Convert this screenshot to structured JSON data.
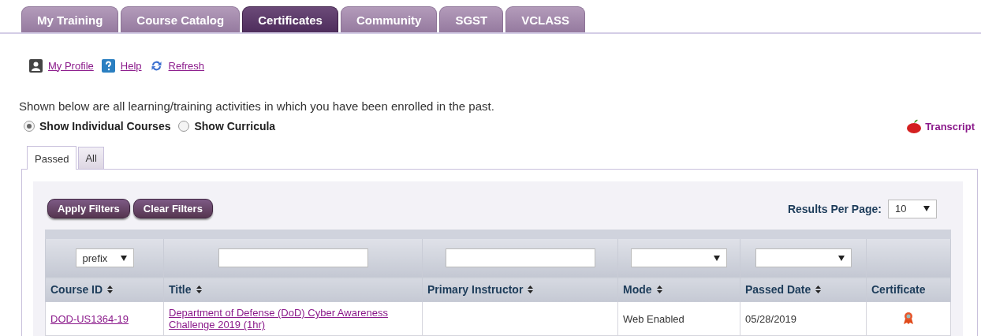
{
  "nav_tabs": [
    {
      "label": "My Training",
      "selected": false
    },
    {
      "label": "Course Catalog",
      "selected": false
    },
    {
      "label": "Certificates",
      "selected": true
    },
    {
      "label": "Community",
      "selected": false
    },
    {
      "label": "SGST",
      "selected": false
    },
    {
      "label": "VCLASS",
      "selected": false
    }
  ],
  "links": [
    {
      "kind": "profile",
      "label": "My Profile"
    },
    {
      "kind": "help",
      "label": "Help"
    },
    {
      "kind": "refresh",
      "label": "Refresh"
    }
  ],
  "intro": "Shown below are all learning/training activities in which you have been enrolled in the past.",
  "view_options": [
    {
      "label": "Show Individual Courses",
      "selected": true
    },
    {
      "label": "Show Curricula",
      "selected": false
    }
  ],
  "transcript_link": "Transcript",
  "sub_tabs": [
    {
      "label": "Passed",
      "selected": true
    },
    {
      "label": "All",
      "selected": false
    }
  ],
  "buttons": [
    "Apply Filters",
    "Clear Filters"
  ],
  "results_per_page": {
    "label": "Results Per Page:",
    "value": "10"
  },
  "table": {
    "filters": [
      {
        "kind": "select",
        "value": "prefix"
      },
      {
        "kind": "text"
      },
      {
        "kind": "text"
      },
      {
        "kind": "select"
      },
      {
        "kind": "select"
      },
      {
        "kind": "none"
      }
    ],
    "columns": [
      {
        "label": "Course ID",
        "sortable": true
      },
      {
        "label": "Title",
        "sortable": true
      },
      {
        "label": "Primary Instructor",
        "sortable": true
      },
      {
        "label": "Mode",
        "sortable": true
      },
      {
        "label": "Passed Date",
        "sortable": true
      },
      {
        "label": "Certificate",
        "sortable": false
      }
    ],
    "rows": [
      {
        "course_id": "DOD-US1364-19",
        "title": "Department of Defense (DoD) Cyber Awareness Challenge 2019 (1hr)",
        "mode": "Web Enabled",
        "passed_date": "05/28/2019"
      }
    ]
  }
}
